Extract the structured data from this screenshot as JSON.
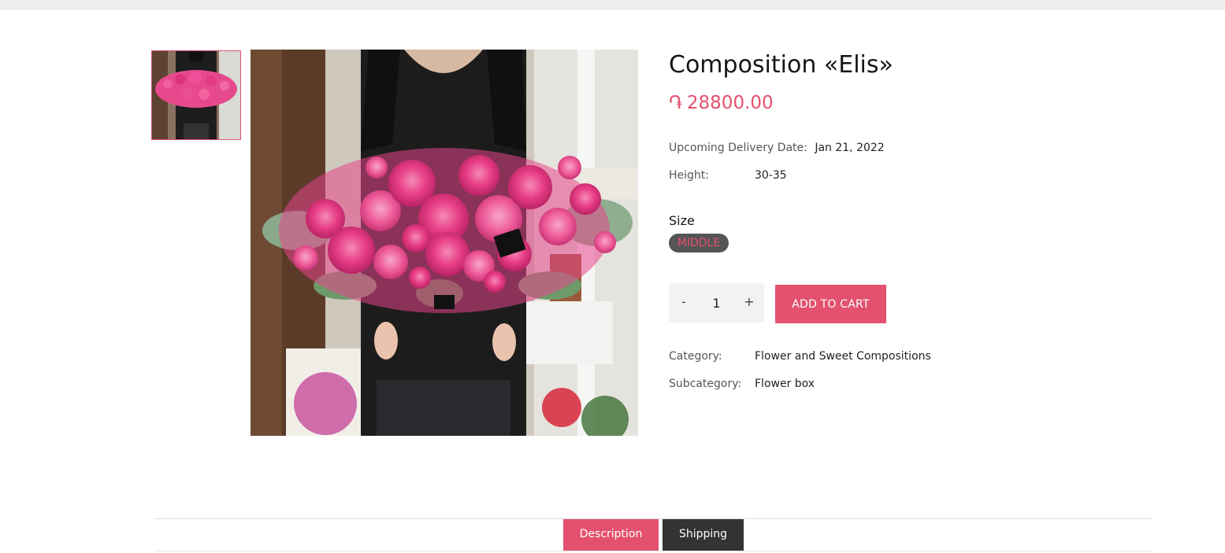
{
  "product": {
    "title": "Composition «Elis»",
    "currency_symbol": "֏",
    "price": "28800.00",
    "delivery_label": "Upcoming Delivery Date:",
    "delivery_value": "Jan 21, 2022",
    "height_label": "Height:",
    "height_value": "30-35",
    "size_label": "Size",
    "size_option": "MIDDLE",
    "quantity": "1",
    "minus_label": "-",
    "plus_label": "+",
    "add_to_cart": "ADD TO CART",
    "category_label": "Category:",
    "category_value": "Flower and Sweet Compositions",
    "subcategory_label": "Subcategory:",
    "subcategory_value": "Flower box"
  },
  "tabs": [
    {
      "label": "Description",
      "active": true
    },
    {
      "label": "Shipping",
      "active": false
    }
  ],
  "colors": {
    "accent": "#e3516e",
    "dark_tab": "#333333",
    "chip_bg": "#555555"
  }
}
